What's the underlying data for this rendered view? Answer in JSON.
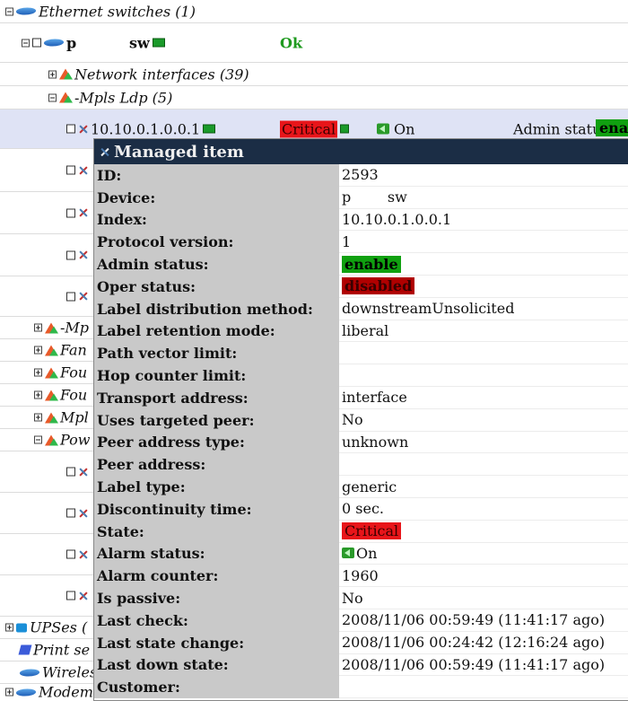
{
  "tree": {
    "ethernet_switches": "Ethernet switches (1)",
    "device_name": "p",
    "device_type": "sw",
    "device_status": "Ok",
    "network_interfaces": "Network interfaces (39)",
    "mpls_ldp": "-Mpls Ldp (5)",
    "selected_item": "10.10.0.1.0.0.1",
    "selected_state": "Critical",
    "selected_alarm": "On",
    "admin_status_label": "Admin status:",
    "admin_status_value": "ena",
    "group_rows": [
      "-Mp",
      "Fan",
      "Fou",
      "Fou",
      "Mpl",
      "Pow"
    ],
    "ups": "UPSes (",
    "print": "Print se",
    "wireless": "Wireles",
    "modem": "Modem"
  },
  "popup": {
    "title": "Managed item",
    "fields": [
      {
        "label": "ID:",
        "value": "2593"
      },
      {
        "label": "Device:",
        "value": "p        sw"
      },
      {
        "label": "Index:",
        "value": "10.10.0.1.0.0.1"
      },
      {
        "label": "Protocol version:",
        "value": "1"
      },
      {
        "label": "Admin status:",
        "value": "enable"
      },
      {
        "label": "Oper status:",
        "value": "disabled"
      },
      {
        "label": "Label distribution method:",
        "value": "downstreamUnsolicited"
      },
      {
        "label": "Label retention mode:",
        "value": "liberal"
      },
      {
        "label": "Path vector limit:",
        "value": ""
      },
      {
        "label": "Hop counter limit:",
        "value": ""
      },
      {
        "label": "Transport address:",
        "value": "interface"
      },
      {
        "label": "Uses targeted peer:",
        "value": "No"
      },
      {
        "label": "Peer address type:",
        "value": "unknown"
      },
      {
        "label": "Peer address:",
        "value": ""
      },
      {
        "label": "Label type:",
        "value": "generic"
      },
      {
        "label": "Discontinuity time:",
        "value": "0 sec."
      },
      {
        "label": "State:",
        "value": "Critical"
      },
      {
        "label": "Alarm status:",
        "value": "On"
      },
      {
        "label": "Alarm counter:",
        "value": "1960"
      },
      {
        "label": "Is passive:",
        "value": "No"
      },
      {
        "label": "Last check:",
        "value": "2008/11/06 00:59:49 (11:41:17 ago)"
      },
      {
        "label": "Last state change:",
        "value": "2008/11/06 00:24:42 (12:16:24 ago)"
      },
      {
        "label": "Last down state:",
        "value": "2008/11/06 00:59:49 (11:41:17 ago)"
      },
      {
        "label": "Customer:",
        "value": ""
      }
    ]
  }
}
